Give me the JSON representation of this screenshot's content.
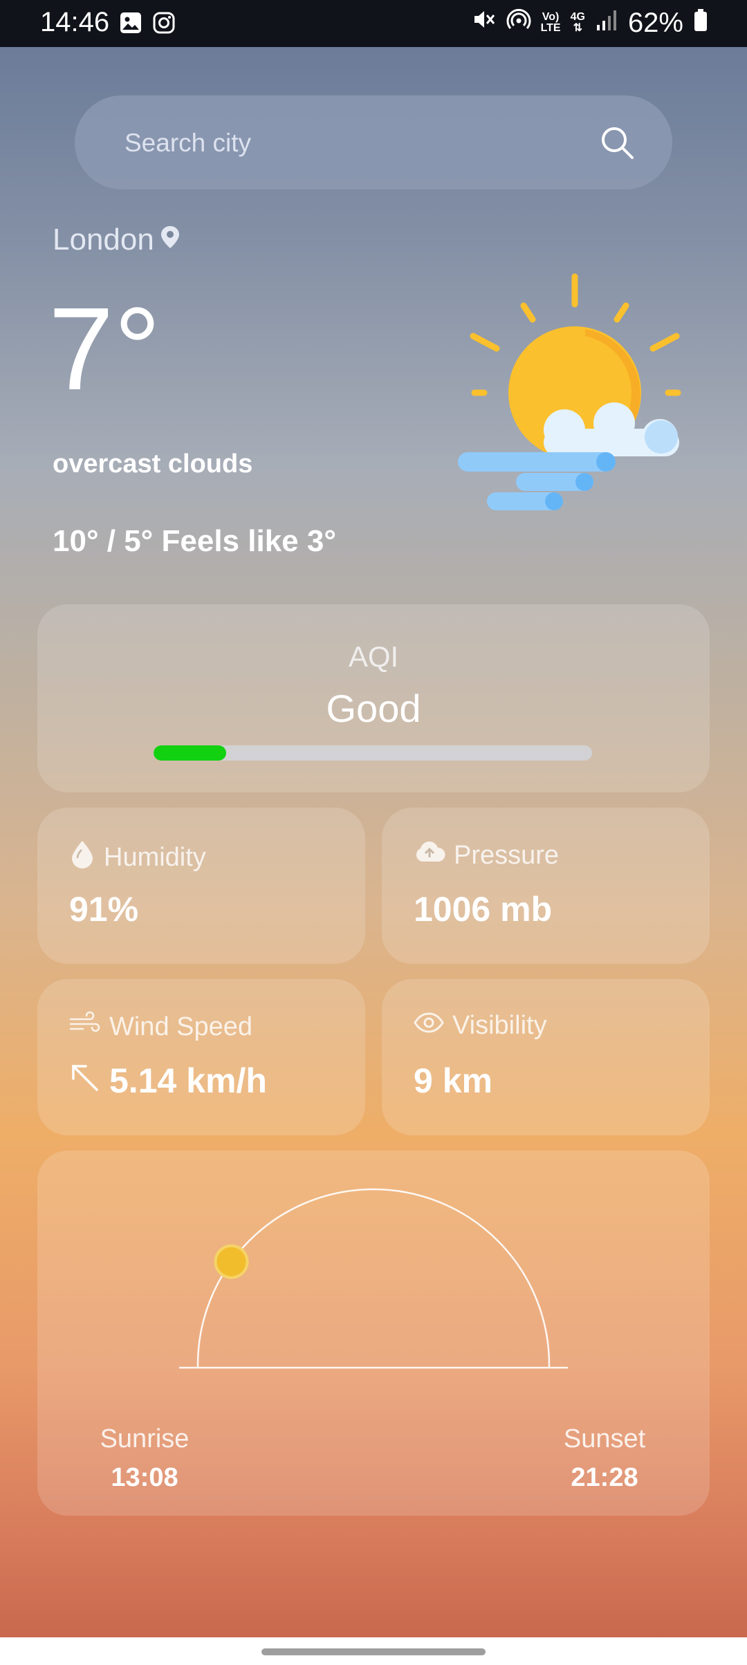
{
  "status_bar": {
    "time": "14:46",
    "battery": "62%",
    "network_top": "Vo)",
    "network_bottom": "LTE",
    "data_type": "4G",
    "icons": [
      "gallery-icon",
      "instagram-icon",
      "mute-icon",
      "hotspot-icon",
      "volte-icon",
      "data-arrows-icon",
      "signal-icon",
      "battery-icon"
    ]
  },
  "search": {
    "placeholder": "Search city",
    "value": ""
  },
  "current": {
    "city": "London",
    "temperature": "7°",
    "description": "overcast clouds",
    "range": "10° / 5° Feels like 3°",
    "icon": "sun-behind-cloud-icon"
  },
  "aqi": {
    "label": "AQI",
    "value": "Good",
    "level": 0.165,
    "bar_color": "#11d111"
  },
  "stats": {
    "humidity": {
      "label": "Humidity",
      "value": "91%"
    },
    "pressure": {
      "label": "Pressure",
      "value": "1006 mb"
    },
    "wind": {
      "label": "Wind Speed",
      "value": "5.14 km/h"
    },
    "visibility": {
      "label": "Visibility",
      "value": "9 km"
    }
  },
  "sun": {
    "sunrise_label": "Sunrise",
    "sunrise": "13:08",
    "sunset_label": "Sunset",
    "sunset": "21:28",
    "progress": 0.2
  },
  "colors": {
    "sun_yellow": "#fbc02d",
    "sun_orange": "#f5a623",
    "cloud_blue": "#90caf9"
  }
}
